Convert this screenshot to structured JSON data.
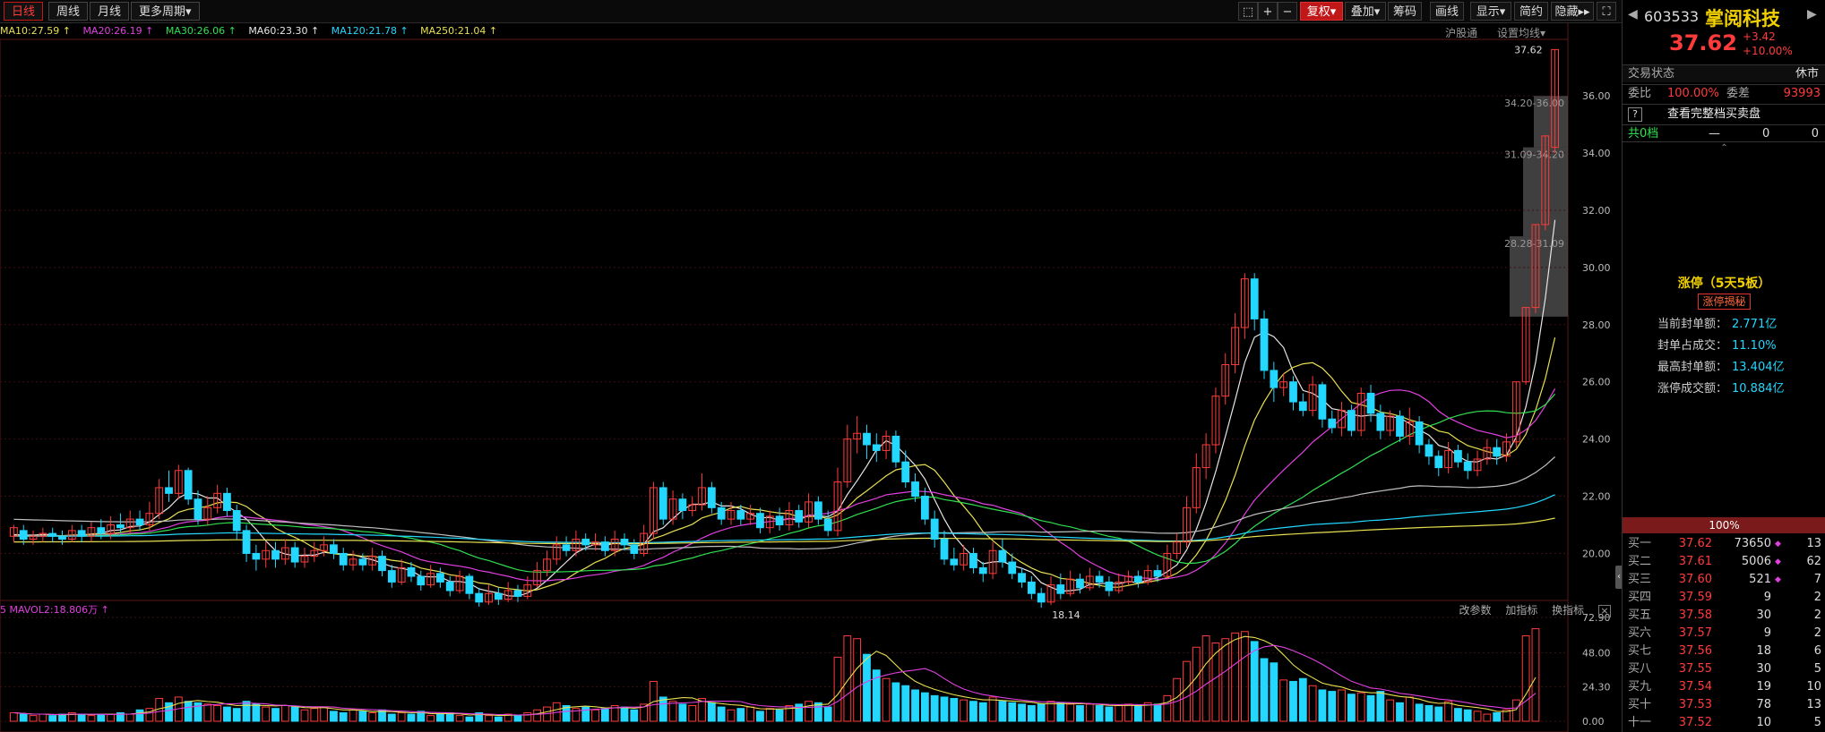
{
  "periods": {
    "items": [
      "日线",
      "周线",
      "月线",
      "更多周期▾"
    ],
    "active": 0
  },
  "toolbar": {
    "icons": [
      "⬚",
      "+",
      "−"
    ],
    "fuquan": "复权▾",
    "overlay": "叠加▾",
    "chips": "筹码",
    "draw": "画线",
    "display": "显示▾",
    "simple": "简约",
    "hide": "隐藏▸▸",
    "fullscreen": "⛶"
  },
  "ma_legend": [
    {
      "text": "MA10:27.59 ↑",
      "color": "#e8e050"
    },
    {
      "text": "MA20:26.19 ↑",
      "color": "#e040e0"
    },
    {
      "text": "MA30:26.06 ↑",
      "color": "#30e050"
    },
    {
      "text": "MA60:23.30 ↑",
      "color": "#e6e6e6"
    },
    {
      "text": "MA120:21.78 ↑",
      "color": "#23d7ff"
    },
    {
      "text": "MA250:21.04 ↑",
      "color": "#e8e050"
    }
  ],
  "main_links": {
    "index": "沪股通",
    "settings": "设置均线▾"
  },
  "vol_legend": "5  MAVOL2:18.806万 ↑",
  "vol_toolbar": {
    "params": "改参数",
    "add": "加指标",
    "switch": "换指标",
    "close": "×"
  },
  "chart_data": {
    "type": "candlestick",
    "price_ticks": [
      "36.00",
      "34.00",
      "32.00",
      "30.00",
      "28.00",
      "26.00",
      "24.00",
      "22.00",
      "20.00"
    ],
    "vol_ticks": [
      "72.90",
      "48.00",
      "24.30",
      "0.00"
    ],
    "price_range": [
      18.7,
      37.6
    ],
    "vol_range": [
      0,
      72.9
    ],
    "last_price_label": "37.62",
    "low_label": "18.14",
    "chip_zones": [
      {
        "label": "34.20-36.00",
        "lo": 34.2,
        "hi": 36.0
      },
      {
        "label": "31.09-34.20",
        "lo": 31.09,
        "hi": 34.2
      },
      {
        "label": "28.28-31.09",
        "lo": 28.28,
        "hi": 31.09
      }
    ],
    "candles": [
      [
        20.6,
        20.9,
        20.4,
        21.0
      ],
      [
        20.8,
        20.5,
        20.3,
        21.0
      ],
      [
        20.5,
        20.6,
        20.3,
        20.8
      ],
      [
        20.6,
        20.7,
        20.4,
        20.9
      ],
      [
        20.7,
        20.6,
        20.4,
        20.9
      ],
      [
        20.6,
        20.5,
        20.3,
        20.8
      ],
      [
        20.5,
        20.8,
        20.4,
        21.0
      ],
      [
        20.8,
        20.6,
        20.4,
        21.0
      ],
      [
        20.6,
        20.9,
        20.4,
        21.1
      ],
      [
        20.9,
        20.7,
        20.5,
        21.2
      ],
      [
        20.7,
        21.0,
        20.5,
        21.3
      ],
      [
        21.0,
        20.9,
        20.7,
        21.4
      ],
      [
        20.9,
        21.2,
        20.7,
        21.5
      ],
      [
        21.2,
        21.0,
        20.8,
        21.5
      ],
      [
        21.0,
        21.4,
        20.8,
        21.8
      ],
      [
        21.4,
        22.3,
        21.2,
        22.6
      ],
      [
        22.3,
        22.1,
        21.8,
        22.9
      ],
      [
        22.1,
        22.9,
        21.9,
        23.1
      ],
      [
        22.9,
        21.9,
        21.7,
        23.0
      ],
      [
        21.9,
        21.2,
        21.0,
        22.2
      ],
      [
        21.2,
        21.6,
        21.0,
        22.0
      ],
      [
        21.6,
        22.1,
        21.4,
        22.4
      ],
      [
        22.1,
        21.5,
        21.3,
        22.3
      ],
      [
        21.5,
        20.8,
        20.5,
        21.7
      ],
      [
        20.8,
        20.0,
        19.7,
        21.0
      ],
      [
        20.0,
        19.8,
        19.4,
        20.3
      ],
      [
        19.8,
        20.1,
        19.5,
        20.4
      ],
      [
        20.1,
        19.8,
        19.5,
        20.4
      ],
      [
        19.8,
        20.2,
        19.6,
        20.5
      ],
      [
        20.2,
        19.7,
        19.5,
        20.4
      ],
      [
        19.7,
        19.9,
        19.5,
        20.2
      ],
      [
        19.9,
        20.1,
        19.7,
        20.4
      ],
      [
        20.1,
        20.3,
        19.9,
        20.6
      ],
      [
        20.3,
        20.0,
        19.8,
        20.5
      ],
      [
        20.0,
        19.6,
        19.4,
        20.2
      ],
      [
        19.6,
        19.8,
        19.4,
        20.1
      ],
      [
        19.8,
        19.6,
        19.4,
        20.0
      ],
      [
        19.6,
        19.9,
        19.4,
        20.2
      ],
      [
        19.9,
        19.4,
        19.2,
        20.1
      ],
      [
        19.4,
        19.0,
        18.8,
        19.6
      ],
      [
        19.0,
        19.5,
        18.9,
        19.8
      ],
      [
        19.5,
        19.2,
        19.0,
        19.7
      ],
      [
        19.2,
        18.9,
        18.7,
        19.4
      ],
      [
        18.9,
        19.3,
        18.8,
        19.6
      ],
      [
        19.3,
        19.0,
        18.8,
        19.5
      ],
      [
        19.0,
        18.7,
        18.5,
        19.2
      ],
      [
        18.7,
        19.2,
        18.6,
        19.4
      ],
      [
        19.2,
        18.6,
        18.4,
        19.3
      ],
      [
        18.6,
        18.3,
        18.14,
        18.8
      ],
      [
        18.3,
        18.6,
        18.2,
        18.9
      ],
      [
        18.6,
        18.4,
        18.2,
        18.8
      ],
      [
        18.4,
        18.7,
        18.3,
        19.0
      ],
      [
        18.7,
        18.5,
        18.3,
        18.9
      ],
      [
        18.5,
        18.9,
        18.4,
        19.2
      ],
      [
        18.9,
        19.4,
        18.8,
        19.7
      ],
      [
        19.4,
        19.8,
        19.2,
        20.1
      ],
      [
        19.8,
        20.3,
        19.6,
        20.6
      ],
      [
        20.3,
        20.1,
        19.9,
        20.6
      ],
      [
        20.1,
        20.5,
        19.9,
        20.8
      ],
      [
        20.5,
        20.3,
        20.1,
        20.7
      ],
      [
        20.3,
        20.4,
        20.1,
        20.7
      ],
      [
        20.4,
        20.1,
        19.9,
        20.6
      ],
      [
        20.1,
        20.5,
        19.9,
        20.8
      ],
      [
        20.5,
        20.3,
        20.1,
        20.7
      ],
      [
        20.3,
        20.0,
        19.8,
        20.5
      ],
      [
        20.0,
        20.7,
        19.9,
        21.0
      ],
      [
        20.7,
        22.3,
        20.5,
        22.5
      ],
      [
        22.3,
        21.2,
        21.0,
        22.5
      ],
      [
        21.2,
        21.9,
        21.0,
        22.2
      ],
      [
        21.9,
        21.5,
        21.2,
        22.1
      ],
      [
        21.5,
        21.7,
        21.3,
        22.0
      ],
      [
        21.7,
        22.3,
        21.5,
        22.8
      ],
      [
        22.3,
        21.6,
        21.4,
        22.5
      ],
      [
        21.6,
        21.2,
        21.0,
        21.8
      ],
      [
        21.2,
        21.5,
        21.0,
        21.8
      ],
      [
        21.5,
        21.2,
        21.0,
        21.7
      ],
      [
        21.2,
        21.4,
        21.0,
        21.7
      ],
      [
        21.4,
        20.9,
        20.7,
        21.6
      ],
      [
        20.9,
        21.3,
        20.7,
        21.5
      ],
      [
        21.3,
        21.0,
        20.8,
        21.6
      ],
      [
        21.0,
        21.5,
        20.8,
        21.8
      ],
      [
        21.5,
        21.1,
        20.9,
        21.7
      ],
      [
        21.1,
        21.8,
        20.9,
        22.1
      ],
      [
        21.8,
        21.2,
        21.0,
        22.0
      ],
      [
        21.2,
        20.8,
        20.6,
        21.5
      ],
      [
        20.8,
        22.5,
        20.6,
        23.0
      ],
      [
        22.5,
        24.0,
        22.3,
        24.5
      ],
      [
        24.0,
        24.2,
        23.5,
        24.8
      ],
      [
        24.2,
        23.8,
        23.3,
        24.5
      ],
      [
        23.8,
        23.6,
        23.2,
        24.2
      ],
      [
        23.6,
        24.1,
        23.3,
        24.3
      ],
      [
        24.1,
        23.2,
        23.0,
        24.3
      ],
      [
        23.2,
        22.5,
        22.3,
        23.6
      ],
      [
        22.5,
        22.0,
        21.8,
        22.8
      ],
      [
        22.0,
        21.2,
        21.0,
        22.3
      ],
      [
        21.2,
        20.5,
        20.2,
        21.5
      ],
      [
        20.5,
        19.8,
        19.6,
        20.8
      ],
      [
        19.8,
        19.6,
        19.4,
        20.2
      ],
      [
        19.6,
        20.0,
        19.4,
        20.3
      ],
      [
        20.0,
        19.5,
        19.3,
        20.2
      ],
      [
        19.5,
        19.3,
        19.0,
        19.7
      ],
      [
        19.3,
        20.1,
        19.1,
        20.4
      ],
      [
        20.1,
        19.7,
        19.5,
        20.5
      ],
      [
        19.7,
        19.3,
        19.1,
        20.0
      ],
      [
        19.3,
        19.0,
        18.8,
        19.5
      ],
      [
        19.0,
        18.6,
        18.4,
        19.2
      ],
      [
        18.6,
        18.3,
        18.1,
        18.8
      ],
      [
        18.3,
        18.9,
        18.2,
        19.2
      ],
      [
        18.9,
        18.6,
        18.4,
        19.3
      ],
      [
        18.6,
        19.1,
        18.5,
        19.4
      ],
      [
        19.1,
        18.8,
        18.6,
        19.3
      ],
      [
        18.8,
        19.2,
        18.7,
        19.5
      ],
      [
        19.2,
        19.0,
        18.8,
        19.4
      ],
      [
        19.0,
        18.7,
        18.5,
        19.2
      ],
      [
        18.7,
        19.0,
        18.6,
        19.3
      ],
      [
        19.0,
        19.2,
        18.9,
        19.4
      ],
      [
        19.2,
        19.0,
        18.8,
        19.4
      ],
      [
        19.0,
        19.4,
        18.9,
        19.6
      ],
      [
        19.4,
        19.2,
        19.0,
        19.6
      ],
      [
        19.2,
        20.0,
        19.1,
        20.3
      ],
      [
        20.0,
        20.4,
        19.8,
        20.7
      ],
      [
        20.4,
        21.6,
        20.2,
        22.0
      ],
      [
        21.6,
        23.0,
        21.4,
        23.5
      ],
      [
        23.0,
        23.8,
        22.6,
        24.2
      ],
      [
        23.8,
        25.5,
        23.5,
        25.8
      ],
      [
        25.5,
        26.6,
        25.2,
        27.0
      ],
      [
        26.6,
        27.9,
        26.3,
        28.4
      ],
      [
        27.9,
        29.6,
        27.5,
        29.8
      ],
      [
        29.6,
        28.2,
        27.8,
        29.8
      ],
      [
        28.2,
        26.4,
        26.1,
        28.5
      ],
      [
        26.4,
        25.8,
        25.3,
        26.7
      ],
      [
        25.8,
        26.0,
        25.5,
        26.3
      ],
      [
        26.0,
        25.3,
        25.0,
        26.2
      ],
      [
        25.3,
        25.0,
        24.8,
        25.6
      ],
      [
        25.0,
        25.9,
        24.8,
        26.2
      ],
      [
        25.9,
        24.7,
        24.4,
        26.0
      ],
      [
        24.7,
        24.4,
        24.2,
        25.0
      ],
      [
        24.4,
        25.0,
        24.1,
        25.3
      ],
      [
        25.0,
        24.3,
        24.1,
        25.2
      ],
      [
        24.3,
        25.6,
        24.1,
        25.8
      ],
      [
        25.6,
        24.9,
        24.6,
        25.9
      ],
      [
        24.9,
        24.3,
        24.0,
        25.2
      ],
      [
        24.3,
        24.8,
        24.1,
        25.0
      ],
      [
        24.8,
        24.1,
        23.9,
        25.0
      ],
      [
        24.1,
        24.6,
        23.8,
        25.1
      ],
      [
        24.6,
        23.8,
        23.5,
        24.8
      ],
      [
        23.8,
        23.4,
        23.1,
        24.0
      ],
      [
        23.4,
        23.0,
        22.7,
        23.6
      ],
      [
        23.0,
        23.6,
        22.8,
        23.9
      ],
      [
        23.6,
        23.2,
        23.0,
        23.8
      ],
      [
        23.2,
        22.9,
        22.6,
        23.5
      ],
      [
        22.9,
        23.3,
        22.7,
        23.6
      ],
      [
        23.3,
        23.7,
        23.1,
        24.0
      ],
      [
        23.7,
        23.4,
        23.1,
        24.0
      ],
      [
        23.4,
        23.9,
        23.2,
        24.2
      ],
      [
        23.9,
        26.0,
        23.7,
        26.0
      ],
      [
        26.0,
        28.6,
        25.9,
        28.6
      ],
      [
        28.6,
        31.5,
        28.4,
        31.5
      ],
      [
        31.5,
        34.6,
        31.3,
        34.6
      ],
      [
        34.2,
        37.62,
        34.0,
        37.62
      ]
    ],
    "volumes": [
      6,
      5,
      4,
      5,
      4,
      5,
      6,
      5,
      4,
      5,
      5,
      6,
      5,
      8,
      9,
      16,
      13,
      17,
      14,
      13,
      12,
      11,
      10,
      9,
      14,
      12,
      10,
      9,
      11,
      10,
      8,
      9,
      10,
      7,
      6,
      8,
      7,
      6,
      8,
      5,
      6,
      5,
      7,
      4,
      5,
      6,
      4,
      3,
      6,
      4,
      3,
      5,
      4,
      6,
      8,
      10,
      13,
      11,
      9,
      10,
      8,
      9,
      11,
      10,
      8,
      12,
      28,
      17,
      14,
      12,
      11,
      16,
      13,
      10,
      8,
      9,
      10,
      7,
      9,
      8,
      11,
      12,
      14,
      13,
      10,
      45,
      60,
      58,
      47,
      36,
      30,
      27,
      25,
      22,
      20,
      18,
      17,
      16,
      15,
      14,
      13,
      17,
      14,
      13,
      12,
      11,
      12,
      14,
      13,
      12,
      11,
      12,
      11,
      10,
      11,
      12,
      11,
      13,
      12,
      18,
      30,
      42,
      52,
      60,
      55,
      58,
      62,
      63,
      56,
      44,
      41,
      29,
      28,
      30,
      25,
      22,
      21,
      22,
      19,
      20,
      18,
      21,
      15,
      13,
      17,
      12,
      11,
      10,
      14,
      9,
      8,
      7,
      5,
      6,
      8,
      15,
      60,
      65
    ]
  },
  "quote": {
    "code": "603533",
    "name": "掌阅科技",
    "price": "37.62",
    "change": "+3.42",
    "change_pct": "+10.00%",
    "status_label": "交易状态",
    "status_value": "休市",
    "wb_label": "委比",
    "wb_value": "100.00%",
    "wc_label": "委差",
    "wc_value": "93993",
    "full_book": "查看完整档买卖盘",
    "help": "?",
    "total_label": "共0档",
    "total_dash": "—",
    "total_a": "0",
    "total_b": "0",
    "caret": "⌃"
  },
  "limit_up": {
    "title": "涨停（5天5板）",
    "tag": "涨停揭秘",
    "rows": [
      {
        "k": "当前封单额：",
        "v": "2.771亿"
      },
      {
        "k": "封单占成交：",
        "v": "11.10%"
      },
      {
        "k": "最高封单额：",
        "v": "13.404亿"
      },
      {
        "k": "涨停成交额：",
        "v": "10.884亿"
      }
    ]
  },
  "orderbook": {
    "header": "100%",
    "rows": [
      {
        "label": "买一",
        "price": "37.62",
        "vol": "73650",
        "mark": "◆",
        "cnt": "13"
      },
      {
        "label": "买二",
        "price": "37.61",
        "vol": "5006",
        "mark": "◆",
        "cnt": "62"
      },
      {
        "label": "买三",
        "price": "37.60",
        "vol": "521",
        "mark": "◆",
        "cnt": "7"
      },
      {
        "label": "买四",
        "price": "37.59",
        "vol": "9",
        "mark": "",
        "cnt": "2"
      },
      {
        "label": "买五",
        "price": "37.58",
        "vol": "30",
        "mark": "",
        "cnt": "2"
      },
      {
        "label": "买六",
        "price": "37.57",
        "vol": "9",
        "mark": "",
        "cnt": "2"
      },
      {
        "label": "买七",
        "price": "37.56",
        "vol": "18",
        "mark": "",
        "cnt": "6"
      },
      {
        "label": "买八",
        "price": "37.55",
        "vol": "30",
        "mark": "",
        "cnt": "5"
      },
      {
        "label": "买九",
        "price": "37.54",
        "vol": "19",
        "mark": "",
        "cnt": "10"
      },
      {
        "label": "买十",
        "price": "37.53",
        "vol": "78",
        "mark": "",
        "cnt": "13"
      },
      {
        "label": "十一",
        "price": "37.52",
        "vol": "10",
        "mark": "",
        "cnt": "5"
      }
    ]
  },
  "colors": {
    "up": "#ff3b3b",
    "down": "#23d7ff",
    "grid": "#3a1010",
    "ma": [
      "#e8e050",
      "#e040e0",
      "#30e050",
      "#e6e6e6",
      "#23d7ff",
      "#e8e050"
    ]
  }
}
